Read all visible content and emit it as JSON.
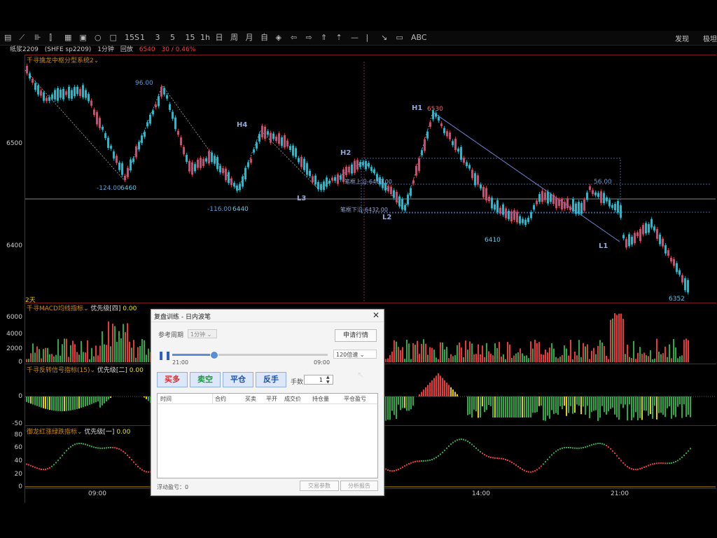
{
  "toolbar": {
    "icons": [
      "table-icon",
      "line-icon",
      "bar-icon",
      "bar2-icon",
      "grid-icon",
      "save-icon",
      "circle-icon",
      "square-icon",
      "15s-icon",
      "1-icon",
      "3-icon",
      "5-icon",
      "15-icon",
      "1h-icon",
      "day-icon",
      "week-icon",
      "month-icon",
      "custom-icon",
      "eye-icon",
      "arrow-left-icon",
      "arrow-right-icon",
      "double-up-icon",
      "up-icon",
      "hline-icon",
      "vline-icon",
      "diag-icon",
      "rect-icon",
      "text-icon"
    ],
    "glyphs": [
      "▤",
      "⟋",
      "⊪",
      "⫿",
      "▦",
      "▣",
      "○",
      "□",
      "15S",
      "1",
      "3",
      "5",
      "15",
      "1h",
      "日",
      "周",
      "月",
      "自",
      "◈",
      "⇦",
      "⇨",
      "⇑",
      "⇡",
      "—",
      "|",
      "↘",
      "▭",
      "ABC"
    ],
    "right_labels": [
      "发现",
      "极坦"
    ]
  },
  "infobar": {
    "symbol": "纸浆2209",
    "exchange": "(SHFE  sp2209)",
    "period": "1分钟",
    "mode": "回放",
    "price": "6540",
    "change": "30 / 0.46%"
  },
  "main_panel": {
    "title": "千寻擒龙中枢分型系统2",
    "y_labels": [
      "6500",
      "6400"
    ],
    "corner_label": "2天",
    "annotations": {
      "p9600": "96.00",
      "h4": "H4",
      "h2": "H2",
      "h1": "H1",
      "h1_price": "6530",
      "l3": "L3",
      "l2": "L2",
      "l1": "L1",
      "v6460": "6460",
      "vm124": "-124.00",
      "v6440": "6440",
      "vm116": "-116.00",
      "v6410": "6410",
      "v6352": "6352",
      "v5600": "56.00",
      "upper_band": "笔框上沿-6460.00",
      "lower_band": "笔框下沿-6432.00"
    }
  },
  "macd_panel": {
    "title": "千寻MACD均线指标",
    "priority": "优先级[四]",
    "value": "0.00",
    "y_labels": [
      "6000",
      "4000",
      "2000",
      "0"
    ]
  },
  "reverse_panel": {
    "title": "千寻反转信号指标(15)",
    "priority": "优先级[二]",
    "value": "0.00",
    "y_labels": [
      "0",
      "-50"
    ]
  },
  "dragon_panel": {
    "title": "御龙红涨绿跌指标",
    "priority": "优先级[一]",
    "value": "0.00",
    "y_labels": [
      "80",
      "60",
      "40",
      "20",
      "0"
    ]
  },
  "x_axis": {
    "labels": [
      "09:00",
      "14:00",
      "21:00"
    ]
  },
  "dialog": {
    "title": "复盘训练 - 日内波笔",
    "close": "✕",
    "ref_period_label": "参考周期",
    "ref_period_value": "1分钟",
    "apply_button": "申请行情",
    "time_start": "21:00",
    "time_end": "09:00",
    "speed_value": "120倍速",
    "pause_icon": "❚❚",
    "buy_long": "买多",
    "sell_short": "卖空",
    "close_pos": "平仓",
    "reverse": "反手",
    "lots_label": "手数",
    "lots_value": "1",
    "table_headers": [
      "时间",
      "合约",
      "买卖",
      "平开",
      "成交价",
      "持仓量",
      "平仓盈亏"
    ],
    "float_pnl_label": "浮动盈亏：0",
    "trade_params_button": "交易参数",
    "analysis_button": "分析报告"
  },
  "colors": {
    "up": "#ff3b3b",
    "down": "#00c8e0",
    "green_bar": "#2fa84a",
    "red_bar": "#e83a3a",
    "dialog_btn_bg": "#dce8fa"
  }
}
